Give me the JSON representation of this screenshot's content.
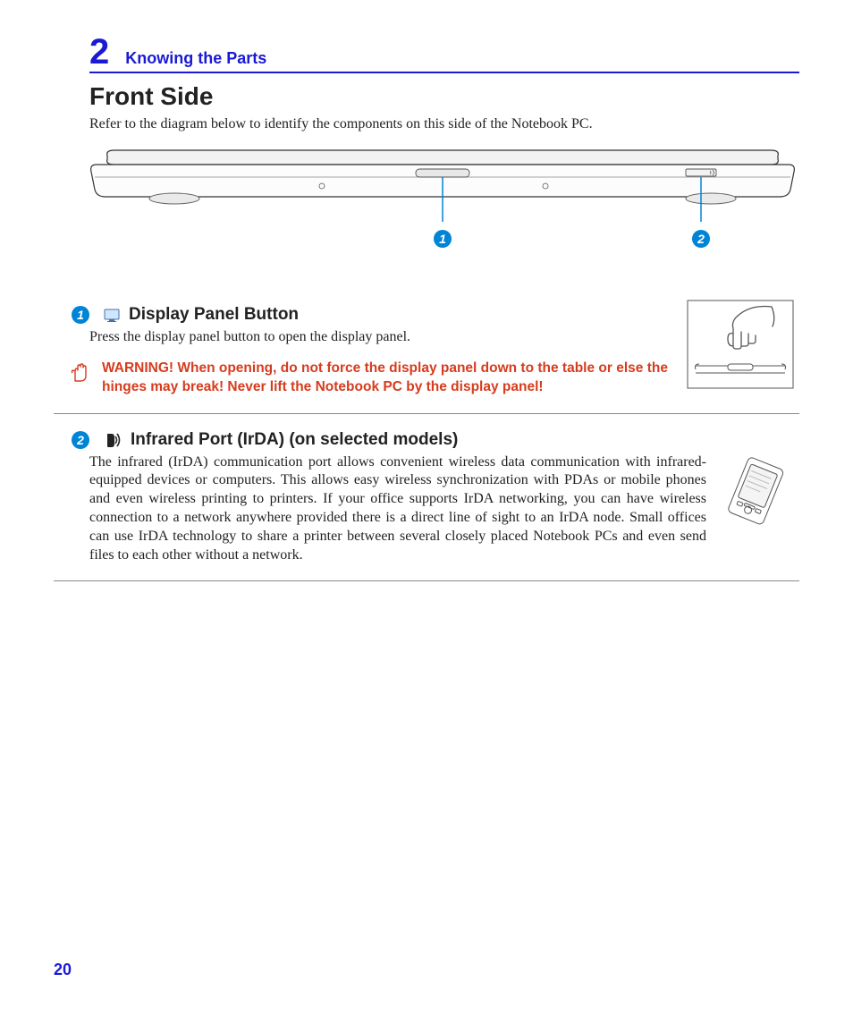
{
  "chapter": {
    "number": "2",
    "title": "Knowing the Parts"
  },
  "section": {
    "title": "Front Side",
    "intro": "Refer to the diagram below to identify the components on this side of the Notebook PC."
  },
  "diagram": {
    "callouts": [
      "1",
      "2"
    ]
  },
  "items": [
    {
      "number": "1",
      "icon": "monitor-icon",
      "title": "Display Panel Button",
      "body": "Press the display panel button to open the display panel.",
      "warning": "WARNING!  When opening, do not force the display panel down to the table or else the hinges may break! Never lift the Notebook PC by the display panel!"
    },
    {
      "number": "2",
      "icon": "irda-icon",
      "title": "Infrared Port (IrDA) (on selected models)",
      "body": "The infrared (IrDA) communication port allows convenient wireless data communication with infrared-equipped devices or computers. This allows easy wireless synchronization with PDAs or mobile phones and even wireless printing to printers. If your office supports IrDA networking, you can have wireless connection to a network anywhere provided there is a direct line of sight to an IrDA node. Small offices can use IrDA technology to share a printer between several closely placed Notebook PCs and even send files to each other without a network."
    }
  ],
  "page_number": "20"
}
